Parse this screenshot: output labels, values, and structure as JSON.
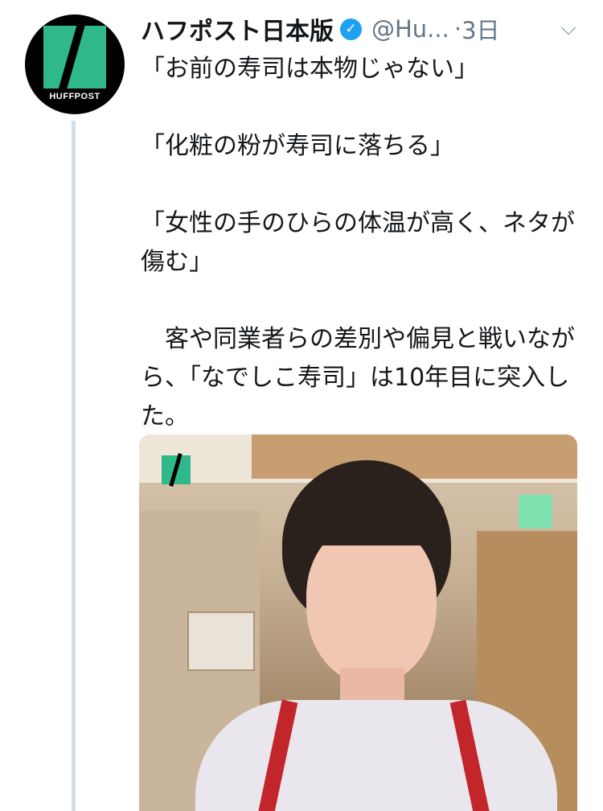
{
  "tweet": {
    "author_name": "ハフポスト日本版",
    "handle": "@Hu...",
    "separator": "·",
    "time": "3日",
    "avatar_text": "HUFFPOST",
    "lines": [
      "「お前の寿司は本物じゃない」",
      "",
      "「化粧の粉が寿司に落ちる」",
      "",
      "「女性の手のひらの体温が高く、ネタが傷む」",
      "",
      "　客や同業者らの差別や偏見と戦いながら、「なでしこ寿司」は10年目に突入した。"
    ]
  },
  "icons": {
    "verified": "verified-badge-icon",
    "menu": "chevron-down-icon"
  },
  "colors": {
    "brand_green": "#2fb88a",
    "verified_blue": "#1da1f2",
    "muted_text": "#657786",
    "thread_line": "#d3dde6"
  }
}
